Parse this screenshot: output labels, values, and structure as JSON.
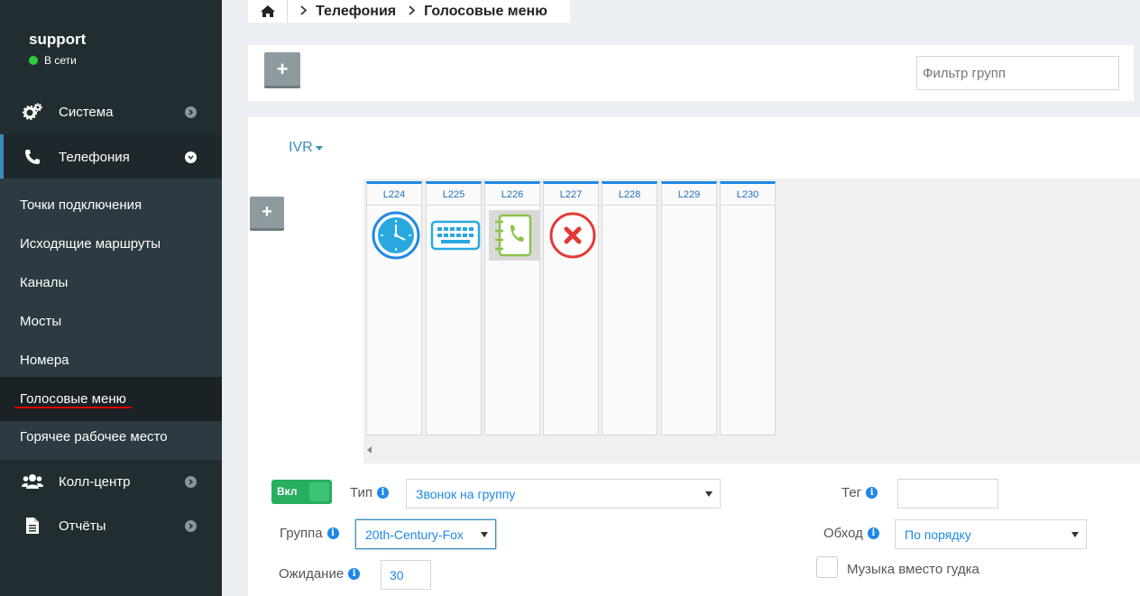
{
  "user": {
    "name": "support",
    "status": "В сети"
  },
  "sidebar": {
    "system": "Система",
    "telephony": "Телефония",
    "callcenter": "Колл-центр",
    "reports": "Отчёты",
    "submenu": [
      "Точки подключения",
      "Исходящие маршруты",
      "Каналы",
      "Мосты",
      "Номера",
      "Голосовые меню",
      "Горячее рабочее место"
    ]
  },
  "breadcrumb": {
    "level1": "Телефония",
    "level2": "Голосовые меню"
  },
  "toolbar": {
    "add_label": "+",
    "filter_placeholder": "Фильтр групп"
  },
  "ivr": {
    "dropdown_label": "IVR",
    "add_label": "+",
    "columns": [
      "L224",
      "L225",
      "L226",
      "L227",
      "L228",
      "L229",
      "L230"
    ],
    "icons": [
      "clock-icon",
      "keyboard-icon",
      "phonebook-icon",
      "cancel-icon"
    ]
  },
  "form": {
    "toggle_label": "Вкл",
    "type_label": "Тип",
    "type_value": "Звонок на группу",
    "group_label": "Группа",
    "group_value": "20th-Century-Fox",
    "wait_label": "Ожидание",
    "wait_value": "30",
    "tag_label": "Тег",
    "tag_value": "",
    "traverse_label": "Обход",
    "traverse_value": "По порядку",
    "music_label": "Музыка вместо гудка"
  },
  "colors": {
    "accent": "#3c8dbc",
    "icon_blue": "#1e88e5",
    "sidebar": "#222d32",
    "toggle": "#27ae60"
  }
}
